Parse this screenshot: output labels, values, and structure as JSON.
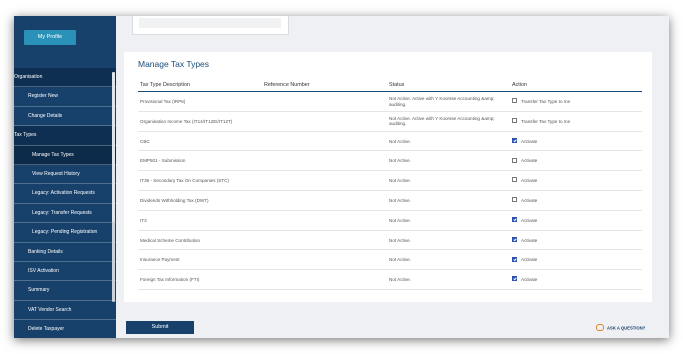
{
  "profile_button": "My Profile",
  "sidebar": {
    "items": [
      {
        "label": "Organisation",
        "kind": "heading"
      },
      {
        "label": "Register New",
        "kind": "lvl1"
      },
      {
        "label": "Change Details",
        "kind": "lvl1"
      },
      {
        "label": "Tax Types",
        "kind": "heading"
      },
      {
        "label": "Manage Tax Types",
        "kind": "lvl2 active"
      },
      {
        "label": "View Request History",
        "kind": "lvl2"
      },
      {
        "label": "Legacy: Activation Requests",
        "kind": "lvl2"
      },
      {
        "label": "Legacy: Transfer Requests",
        "kind": "lvl2"
      },
      {
        "label": "Legacy: Pending Registration",
        "kind": "lvl2"
      },
      {
        "label": "Banking Details",
        "kind": "lvl1"
      },
      {
        "label": "ISV Activation",
        "kind": "lvl1"
      },
      {
        "label": "Summary",
        "kind": "lvl1"
      },
      {
        "label": "VAT Vendor Search",
        "kind": "lvl1"
      },
      {
        "label": "Delete Taxpayer",
        "kind": "lvl1"
      }
    ]
  },
  "main": {
    "title": "Manage Tax Types",
    "columns": {
      "description": "Tax Type Description",
      "reference": "Reference Number",
      "status": "Status",
      "action": "Action"
    },
    "rows": [
      {
        "description": "Provisional Tax (IRP6)",
        "status": "Not Active. Active with Y Koorsse Accounting &amp; auditing.",
        "action": "Transfer Tax Type to me",
        "checked": false
      },
      {
        "description": "Organisation Income Tax (IT14/IT12EI/IT12T)",
        "status": "Not Active. Active with Y Koorsse Accounting &amp; auditing.",
        "action": "Transfer Tax Type to me",
        "checked": false
      },
      {
        "description": "CBC",
        "status": "Not Active.",
        "action": "Activate",
        "checked": true
      },
      {
        "description": "EMP501 - Submission",
        "status": "Not Active.",
        "action": "Activate",
        "checked": false
      },
      {
        "description": "IT36 - Secondary Tax On Companies (STC)",
        "status": "Not Active.",
        "action": "Activate",
        "checked": false
      },
      {
        "description": "Dividends Withholding Tax (DWT)",
        "status": "Not Active.",
        "action": "Activate",
        "checked": false
      },
      {
        "description": "IT3",
        "status": "Not Active.",
        "action": "Activate",
        "checked": true
      },
      {
        "description": "Medical Scheme Contribution",
        "status": "Not Active.",
        "action": "Activate",
        "checked": true
      },
      {
        "description": "Insurance Payment",
        "status": "Not Active.",
        "action": "Activate",
        "checked": true
      },
      {
        "description": "Foreign Tax Information (FTI)",
        "status": "Not Active.",
        "action": "Activate",
        "checked": true
      }
    ]
  },
  "submit_label": "Submit",
  "ask_label": "ASK A QUESTION?"
}
